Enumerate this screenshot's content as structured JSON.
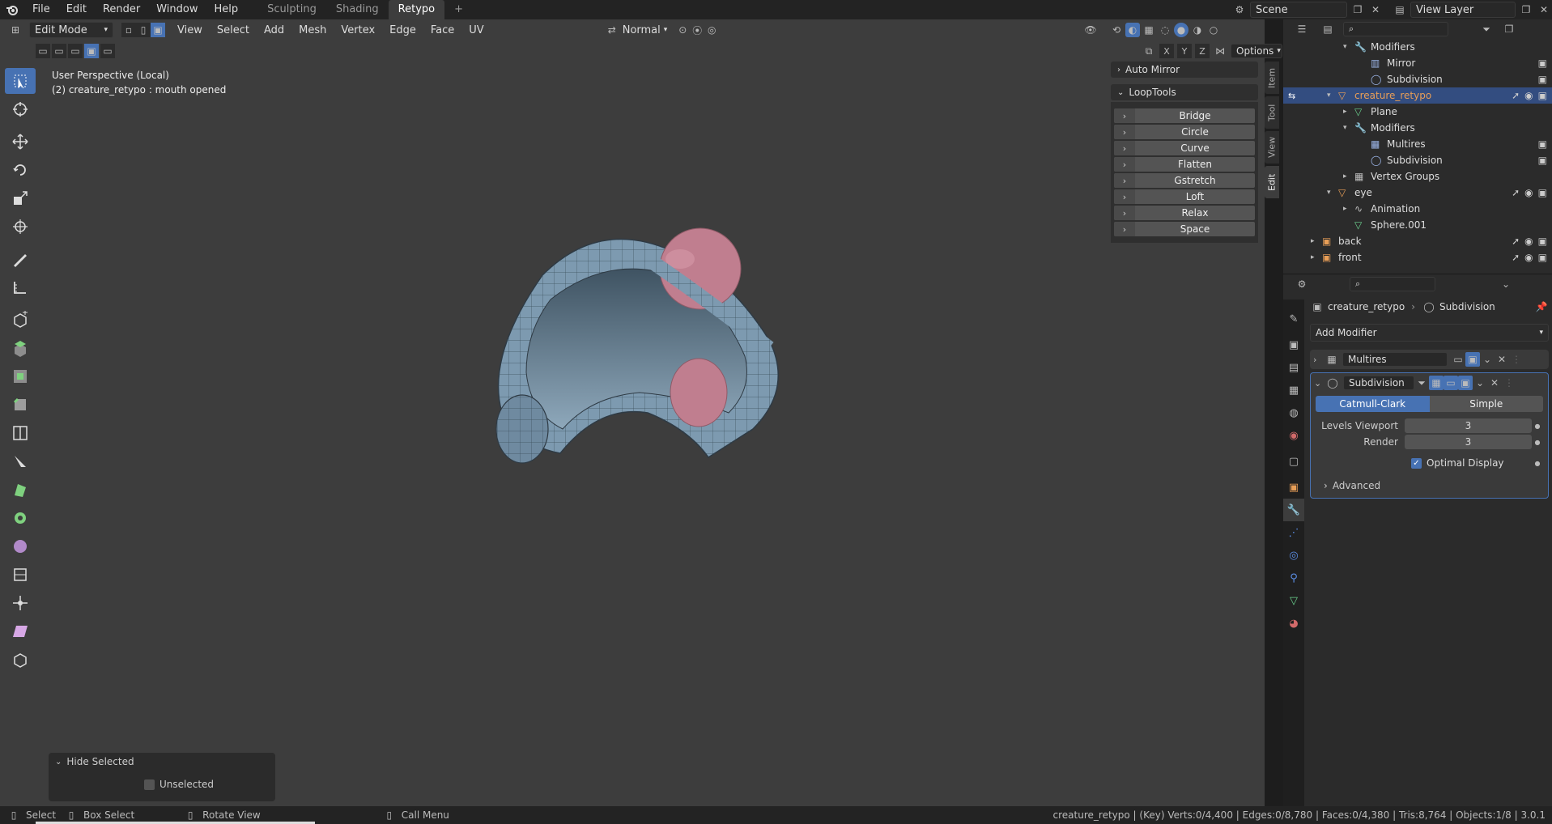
{
  "topbar": {
    "menus": [
      "File",
      "Edit",
      "Render",
      "Window",
      "Help"
    ],
    "workspaces": [
      "Sculpting",
      "Shading",
      "Retypo"
    ],
    "active_workspace": "Retypo",
    "add_tab": "+",
    "scene_label": "Scene",
    "view_layer_label": "View Layer"
  },
  "viewport": {
    "mode": "Edit Mode",
    "menus": [
      "View",
      "Select",
      "Add",
      "Mesh",
      "Vertex",
      "Edge",
      "Face",
      "UV"
    ],
    "orientation": "Normal",
    "axes": [
      "X",
      "Y",
      "Z"
    ],
    "options_label": "Options",
    "overlay_line1": "User Perspective (Local)",
    "overlay_line2": "(2) creature_retypo : mouth opened"
  },
  "tools": [
    "select-box",
    "cursor",
    "move",
    "rotate",
    "scale",
    "transform",
    "annotate",
    "measure",
    "add-cube",
    "extrude",
    "inset",
    "bevel",
    "loop-cut",
    "knife",
    "poly-build",
    "spin",
    "smooth",
    "edge-slide",
    "shrink-fatten",
    "shear",
    "rip"
  ],
  "npanel": {
    "auto_mirror": "Auto Mirror",
    "looptools": "LoopTools",
    "buttons": [
      "Bridge",
      "Circle",
      "Curve",
      "Flatten",
      "Gstretch",
      "Loft",
      "Relax",
      "Space"
    ],
    "tabs": [
      "Item",
      "Tool",
      "View",
      "Edit"
    ]
  },
  "outliner": {
    "rows": [
      {
        "label": "Modifiers",
        "indent": 3,
        "icon": "wrench-icon",
        "exp": "▾"
      },
      {
        "label": "Mirror",
        "indent": 4,
        "icon": "mirror-icon",
        "exp": "",
        "cam": true
      },
      {
        "label": "Subdivision",
        "indent": 4,
        "icon": "subdiv-icon",
        "exp": "",
        "cam": true
      },
      {
        "label": "creature_retypo",
        "indent": 2,
        "icon": "mesh-object-icon",
        "exp": "▾",
        "sel": true,
        "vis": true
      },
      {
        "label": "Plane",
        "indent": 3,
        "icon": "mesh-data-icon",
        "exp": "▸"
      },
      {
        "label": "Modifiers",
        "indent": 3,
        "icon": "wrench-icon",
        "exp": "▾"
      },
      {
        "label": "Multires",
        "indent": 4,
        "icon": "multires-icon",
        "exp": "",
        "cam": true
      },
      {
        "label": "Subdivision",
        "indent": 4,
        "icon": "subdiv-icon",
        "exp": "",
        "cam": true
      },
      {
        "label": "Vertex Groups",
        "indent": 3,
        "icon": "vertex-groups-icon",
        "exp": "▸"
      },
      {
        "label": "eye",
        "indent": 2,
        "icon": "mesh-object-icon",
        "exp": "▾",
        "vis": true
      },
      {
        "label": "Animation",
        "indent": 3,
        "icon": "animation-icon",
        "exp": "▸"
      },
      {
        "label": "Sphere.001",
        "indent": 3,
        "icon": "mesh-data-icon",
        "exp": ""
      },
      {
        "label": "back",
        "indent": 1,
        "icon": "image-icon",
        "exp": "▸",
        "vis": true
      },
      {
        "label": "front",
        "indent": 1,
        "icon": "image-icon",
        "exp": "▸",
        "vis": true
      }
    ]
  },
  "properties": {
    "breadcrumb_object": "creature_retypo",
    "breadcrumb_modifier": "Subdivision",
    "add_modifier": "Add Modifier",
    "mod1_name": "Multires",
    "mod2_name": "Subdivision",
    "catmull": "Catmull-Clark",
    "simple": "Simple",
    "levels_viewport_label": "Levels Viewport",
    "levels_viewport_value": "3",
    "render_label": "Render",
    "render_value": "3",
    "optimal_display": "Optimal Display",
    "advanced": "Advanced"
  },
  "hide_panel": {
    "title": "Hide Selected",
    "option": "Unselected"
  },
  "status": {
    "select": "Select",
    "box_select": "Box Select",
    "rotate_view": "Rotate View",
    "call_menu": "Call Menu",
    "stats": "creature_retypo | (Key) Verts:0/4,400 | Edges:0/8,780 | Faces:0/4,380 | Tris:8,764 | Objects:1/8 | 3.0.1"
  },
  "colors": {
    "accent": "#4772b3",
    "viewport_bg": "#3d3d3d",
    "mesh": "#7d9ab0",
    "eye": "#c07e8f"
  }
}
